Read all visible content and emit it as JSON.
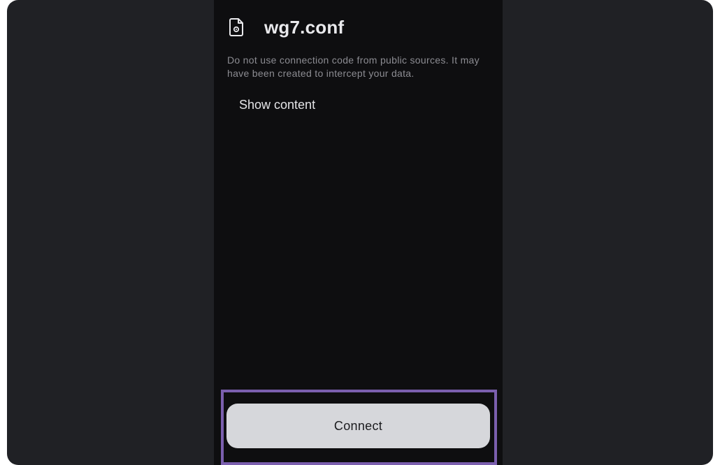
{
  "config": {
    "title": "wg7.conf",
    "icon": "file-settings-icon"
  },
  "warning": {
    "text": "Do not use connection code from public sources. It may have been created to intercept your data."
  },
  "actions": {
    "show_content_label": "Show content",
    "connect_label": "Connect"
  },
  "colors": {
    "background": "#202125",
    "panel": "#0e0e10",
    "button": "#d6d7db",
    "highlight": "#7b5fae"
  }
}
